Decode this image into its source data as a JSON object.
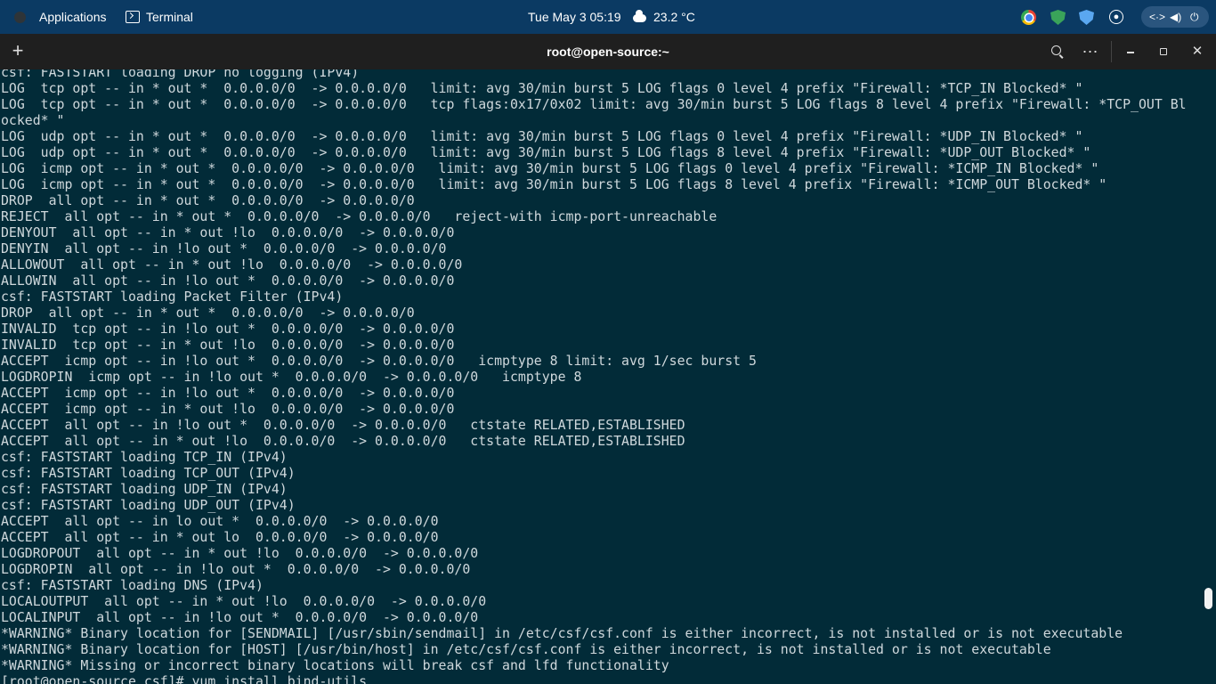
{
  "topbar": {
    "applications": "Applications",
    "app_name": "Terminal",
    "datetime": "Tue May 3  05:19",
    "weather": "23.2 °C",
    "tray_icons": [
      "chrome-icon",
      "shield-green-icon",
      "shield-blue-icon",
      "accessibility-icon",
      "network-icon",
      "volume-icon",
      "power-icon"
    ]
  },
  "window": {
    "title": "root@open-source:~",
    "menu_glyph": "⋯",
    "close_glyph": "✕"
  },
  "terminal": {
    "lines": [
      "csf: FASTSTART loading DROP no logging (IPv4)",
      "LOG  tcp opt -- in * out *  0.0.0.0/0  -> 0.0.0.0/0   limit: avg 30/min burst 5 LOG flags 0 level 4 prefix \"Firewall: *TCP_IN Blocked* \"",
      "LOG  tcp opt -- in * out *  0.0.0.0/0  -> 0.0.0.0/0   tcp flags:0x17/0x02 limit: avg 30/min burst 5 LOG flags 8 level 4 prefix \"Firewall: *TCP_OUT Bl",
      "ocked* \"",
      "LOG  udp opt -- in * out *  0.0.0.0/0  -> 0.0.0.0/0   limit: avg 30/min burst 5 LOG flags 0 level 4 prefix \"Firewall: *UDP_IN Blocked* \"",
      "LOG  udp opt -- in * out *  0.0.0.0/0  -> 0.0.0.0/0   limit: avg 30/min burst 5 LOG flags 8 level 4 prefix \"Firewall: *UDP_OUT Blocked* \"",
      "LOG  icmp opt -- in * out *  0.0.0.0/0  -> 0.0.0.0/0   limit: avg 30/min burst 5 LOG flags 0 level 4 prefix \"Firewall: *ICMP_IN Blocked* \"",
      "LOG  icmp opt -- in * out *  0.0.0.0/0  -> 0.0.0.0/0   limit: avg 30/min burst 5 LOG flags 8 level 4 prefix \"Firewall: *ICMP_OUT Blocked* \"",
      "DROP  all opt -- in * out *  0.0.0.0/0  -> 0.0.0.0/0",
      "REJECT  all opt -- in * out *  0.0.0.0/0  -> 0.0.0.0/0   reject-with icmp-port-unreachable",
      "DENYOUT  all opt -- in * out !lo  0.0.0.0/0  -> 0.0.0.0/0",
      "DENYIN  all opt -- in !lo out *  0.0.0.0/0  -> 0.0.0.0/0",
      "ALLOWOUT  all opt -- in * out !lo  0.0.0.0/0  -> 0.0.0.0/0",
      "ALLOWIN  all opt -- in !lo out *  0.0.0.0/0  -> 0.0.0.0/0",
      "csf: FASTSTART loading Packet Filter (IPv4)",
      "DROP  all opt -- in * out *  0.0.0.0/0  -> 0.0.0.0/0",
      "INVALID  tcp opt -- in !lo out *  0.0.0.0/0  -> 0.0.0.0/0",
      "INVALID  tcp opt -- in * out !lo  0.0.0.0/0  -> 0.0.0.0/0",
      "ACCEPT  icmp opt -- in !lo out *  0.0.0.0/0  -> 0.0.0.0/0   icmptype 8 limit: avg 1/sec burst 5",
      "LOGDROPIN  icmp opt -- in !lo out *  0.0.0.0/0  -> 0.0.0.0/0   icmptype 8",
      "ACCEPT  icmp opt -- in !lo out *  0.0.0.0/0  -> 0.0.0.0/0",
      "ACCEPT  icmp opt -- in * out !lo  0.0.0.0/0  -> 0.0.0.0/0",
      "ACCEPT  all opt -- in !lo out *  0.0.0.0/0  -> 0.0.0.0/0   ctstate RELATED,ESTABLISHED",
      "ACCEPT  all opt -- in * out !lo  0.0.0.0/0  -> 0.0.0.0/0   ctstate RELATED,ESTABLISHED",
      "csf: FASTSTART loading TCP_IN (IPv4)",
      "csf: FASTSTART loading TCP_OUT (IPv4)",
      "csf: FASTSTART loading UDP_IN (IPv4)",
      "csf: FASTSTART loading UDP_OUT (IPv4)",
      "ACCEPT  all opt -- in lo out *  0.0.0.0/0  -> 0.0.0.0/0",
      "ACCEPT  all opt -- in * out lo  0.0.0.0/0  -> 0.0.0.0/0",
      "LOGDROPOUT  all opt -- in * out !lo  0.0.0.0/0  -> 0.0.0.0/0",
      "LOGDROPIN  all opt -- in !lo out *  0.0.0.0/0  -> 0.0.0.0/0",
      "csf: FASTSTART loading DNS (IPv4)",
      "LOCALOUTPUT  all opt -- in * out !lo  0.0.0.0/0  -> 0.0.0.0/0",
      "LOCALINPUT  all opt -- in !lo out *  0.0.0.0/0  -> 0.0.0.0/0",
      "*WARNING* Binary location for [SENDMAIL] [/usr/sbin/sendmail] in /etc/csf/csf.conf is either incorrect, is not installed or is not executable",
      "*WARNING* Binary location for [HOST] [/usr/bin/host] in /etc/csf/csf.conf is either incorrect, is not installed or is not executable",
      "*WARNING* Missing or incorrect binary locations will break csf and lfd functionality",
      "[root@open-source csf]# yum install bind-utils"
    ]
  }
}
